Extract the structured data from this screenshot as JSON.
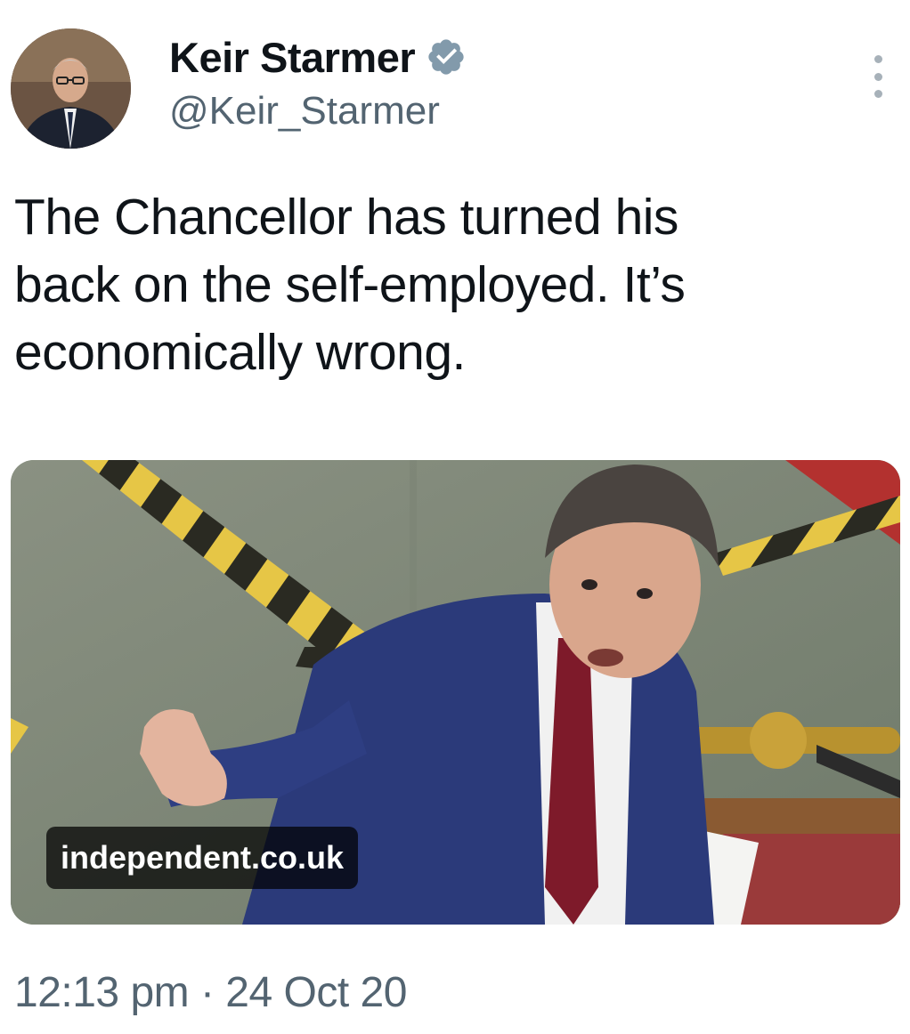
{
  "author": {
    "display_name": "Keir Starmer",
    "handle": "@Keir_Starmer",
    "verified_icon": "verified-badge-icon",
    "avatar_icon": "avatar-photo"
  },
  "header": {
    "more_icon": "more-vertical-icon"
  },
  "tweet": {
    "text": "The Chancellor has turned his\nback on the self-employed. It’s\neconomically wrong."
  },
  "link_card": {
    "domain": "independent.co.uk"
  },
  "meta": {
    "timestamp": "12:13 pm · 24 Oct 20"
  },
  "colors": {
    "text_primary": "#0f1419",
    "text_secondary": "#536471",
    "verified_badge": "#829aab"
  }
}
